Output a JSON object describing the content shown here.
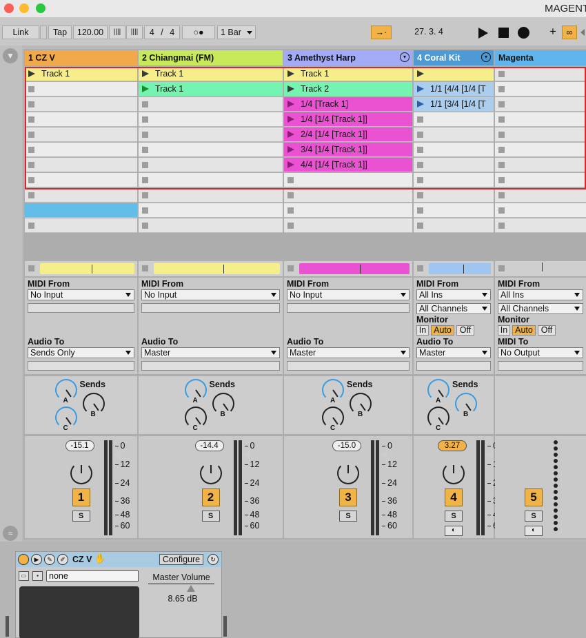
{
  "window": {
    "title": "MAGENT",
    "close_color": "#fd5f57",
    "min_color": "#febb2e",
    "max_color": "#29c840"
  },
  "controlbar": {
    "link": "Link",
    "tap": "Tap",
    "tempo": "120.00",
    "meter_numerator": "4",
    "meter_sep": "/",
    "meter_denominator": "4",
    "metro": "○●",
    "quantize": "1 Bar",
    "position": "27.  3.  4"
  },
  "tracks": [
    {
      "name": "1 CZ V",
      "color": "#f2a94c",
      "clips": [
        {
          "name": "Track 1",
          "color": "#f6ee8a",
          "state": "play"
        },
        {
          "name": "",
          "state": "stop"
        },
        {
          "name": "",
          "state": "stop"
        },
        {
          "name": "",
          "state": "stop"
        },
        {
          "name": "",
          "state": "stop"
        },
        {
          "name": "",
          "state": "stop"
        },
        {
          "name": "",
          "state": "stop"
        },
        {
          "name": "",
          "state": "stop"
        },
        {
          "name": "",
          "state": "stop"
        },
        {
          "name": "",
          "color": "#63bde9",
          "state": "none"
        },
        {
          "name": "",
          "state": "stop"
        }
      ],
      "overview_color": "#f6ee8a",
      "midi_from_label": "MIDI From",
      "midi_from": "No Input",
      "audio_to_label": "Audio To",
      "audio_to": "Sends Only",
      "sends_label": "Sends",
      "send_a": "A",
      "send_b": "B",
      "send_c": "C",
      "volume": "-15.1",
      "number": "1",
      "solo": "S"
    },
    {
      "name": "2 Chiangmai (FM)",
      "color": "#c8ea5a",
      "clips": [
        {
          "name": "Track 1",
          "color": "#f6ee8a",
          "state": "play"
        },
        {
          "name": "Track 1",
          "color": "#74f4b0",
          "state": "playing"
        },
        {
          "name": "",
          "state": "stop"
        },
        {
          "name": "",
          "state": "stop"
        },
        {
          "name": "",
          "state": "stop"
        },
        {
          "name": "",
          "state": "stop"
        },
        {
          "name": "",
          "state": "stop"
        },
        {
          "name": "",
          "state": "stop"
        },
        {
          "name": "",
          "state": "stop"
        },
        {
          "name": "",
          "state": "stop"
        },
        {
          "name": "",
          "state": "stop"
        }
      ],
      "overview_color": "#f6ee8a",
      "midi_from_label": "MIDI From",
      "midi_from": "No Input",
      "audio_to_label": "Audio To",
      "audio_to": "Master",
      "sends_label": "Sends",
      "send_a": "A",
      "send_b": "B",
      "send_c": "C",
      "volume": "-14.4",
      "number": "2",
      "solo": "S"
    },
    {
      "name": "3 Amethyst Harp",
      "color": "#a3aaf6",
      "clips": [
        {
          "name": "Track 1",
          "color": "#f6ee8a",
          "state": "play"
        },
        {
          "name": "Track 2",
          "color": "#74f4b0",
          "state": "play"
        },
        {
          "name": "1/4 [Track 1]",
          "color": "#ea52d2",
          "state": "play"
        },
        {
          "name": "1/4 [1/4 [Track 1]]",
          "color": "#ea52d2",
          "state": "play"
        },
        {
          "name": "2/4 [1/4 [Track 1]]",
          "color": "#ea52d2",
          "state": "play"
        },
        {
          "name": "3/4 [1/4 [Track 1]]",
          "color": "#ea52d2",
          "state": "play"
        },
        {
          "name": "4/4 [1/4 [Track 1]]",
          "color": "#ea52d2",
          "state": "play"
        },
        {
          "name": "",
          "state": "stop"
        },
        {
          "name": "",
          "state": "stop"
        },
        {
          "name": "",
          "state": "stop"
        },
        {
          "name": "",
          "state": "stop"
        }
      ],
      "overview_color": "#ea52d2",
      "midi_from_label": "MIDI From",
      "midi_from": "No Input",
      "audio_to_label": "Audio To",
      "audio_to": "Master",
      "sends_label": "Sends",
      "send_a": "A",
      "send_b": "B",
      "send_c": "C",
      "volume": "-15.0",
      "number": "3",
      "solo": "S"
    },
    {
      "name": "4 Coral Kit",
      "color": "#4e9ad5",
      "clips": [
        {
          "name": "",
          "color": "#f6ee8a",
          "state": "play"
        },
        {
          "name": "1/1 [4/4 [1/4 [T",
          "color": "#abcdee",
          "state": "playblue"
        },
        {
          "name": "1/1 [3/4 [1/4 [T",
          "color": "#abcdee",
          "state": "playblue"
        },
        {
          "name": "",
          "state": "stop"
        },
        {
          "name": "",
          "state": "stop"
        },
        {
          "name": "",
          "state": "stop"
        },
        {
          "name": "",
          "state": "stop"
        },
        {
          "name": "",
          "state": "stop"
        },
        {
          "name": "",
          "state": "stop"
        },
        {
          "name": "",
          "state": "stop"
        },
        {
          "name": "",
          "state": "stop"
        }
      ],
      "overview_color": "#9ec6f1",
      "midi_from_label": "MIDI From",
      "midi_from": "All Ins",
      "channel": "All Channels",
      "monitor_label": "Monitor",
      "mon_in": "In",
      "mon_auto": "Auto",
      "mon_off": "Off",
      "audio_to_label": "Audio To",
      "audio_to": "Master",
      "sends_label": "Sends",
      "send_a": "A",
      "send_b": "B",
      "send_c": "C",
      "volume": "3.27",
      "number": "4",
      "solo": "S"
    },
    {
      "name": "Magenta",
      "color": "#5fb5ec",
      "clips": [
        {
          "name": "",
          "state": "stop"
        },
        {
          "name": "",
          "state": "stop"
        },
        {
          "name": "",
          "state": "stop"
        },
        {
          "name": "",
          "state": "stop"
        },
        {
          "name": "",
          "state": "stop"
        },
        {
          "name": "",
          "state": "stop"
        },
        {
          "name": "",
          "state": "stop"
        },
        {
          "name": "",
          "state": "stop"
        },
        {
          "name": "",
          "state": "stop"
        },
        {
          "name": "",
          "state": "stop"
        },
        {
          "name": "",
          "state": "stop"
        }
      ],
      "overview_color": "",
      "midi_from_label": "MIDI From",
      "midi_from": "All Ins",
      "channel": "All Channels",
      "monitor_label": "Monitor",
      "mon_in": "In",
      "mon_auto": "Auto",
      "mon_off": "Off",
      "midi_to_label": "MIDI To",
      "midi_to": "No Output",
      "number": "5",
      "solo": "S"
    }
  ],
  "meter_scale": [
    "0",
    "12",
    "24",
    "36",
    "48",
    "60"
  ],
  "device": {
    "name": "CZ V",
    "configure": "Configure",
    "preset": "none",
    "param_name": "Master Volume",
    "param_value": "8.65 dB"
  }
}
